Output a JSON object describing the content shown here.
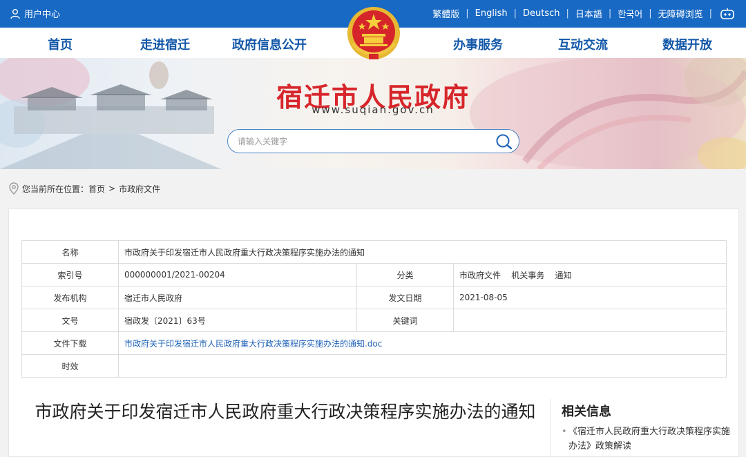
{
  "topbar": {
    "user_center": "用户中心",
    "languages": [
      "繁體版",
      "English",
      "Deutsch",
      "日本語",
      "한국어",
      "无障碍浏览"
    ]
  },
  "nav": {
    "items": [
      "首页",
      "走进宿迁",
      "政府信息公开",
      "办事服务",
      "互动交流",
      "数据开放"
    ]
  },
  "banner": {
    "site_title": "宿迁市人民政府",
    "site_url": "www.suqian.gov.cn",
    "search_placeholder": "请输入关键字"
  },
  "breadcrumb": {
    "prefix": "您当前所在位置：",
    "home": "首页",
    "separator": ">",
    "current": "市政府文件"
  },
  "meta_table": {
    "name_label": "名称",
    "name_value": "市政府关于印发宿迁市人民政府重大行政决策程序实施办法的通知",
    "index_label": "索引号",
    "index_value": "000000001/2021-00204",
    "category_label": "分类",
    "category_value": "市政府文件    机关事务    通知",
    "publisher_label": "发布机构",
    "publisher_value": "宿迁市人民政府",
    "date_label": "发文日期",
    "date_value": "2021-08-05",
    "docno_label": "文号",
    "docno_value": "宿政发〔2021〕63号",
    "keywords_label": "关键词",
    "keywords_value": "",
    "download_label": "文件下载",
    "download_value": "市政府关于印发宿迁市人民政府重大行政决策程序实施办法的通知.doc",
    "validity_label": "时效",
    "validity_value": ""
  },
  "document": {
    "title": "市政府关于印发宿迁市人民政府重大行政决策程序实施办法的通知"
  },
  "related": {
    "heading": "相关信息",
    "items": [
      "《宿迁市人民政府重大行政决策程序实施办法》政策解读"
    ]
  },
  "colors": {
    "topbar": "#1869c4",
    "nav_text": "#1257a8",
    "site_title": "#d7262b",
    "link": "#1f63b8"
  }
}
